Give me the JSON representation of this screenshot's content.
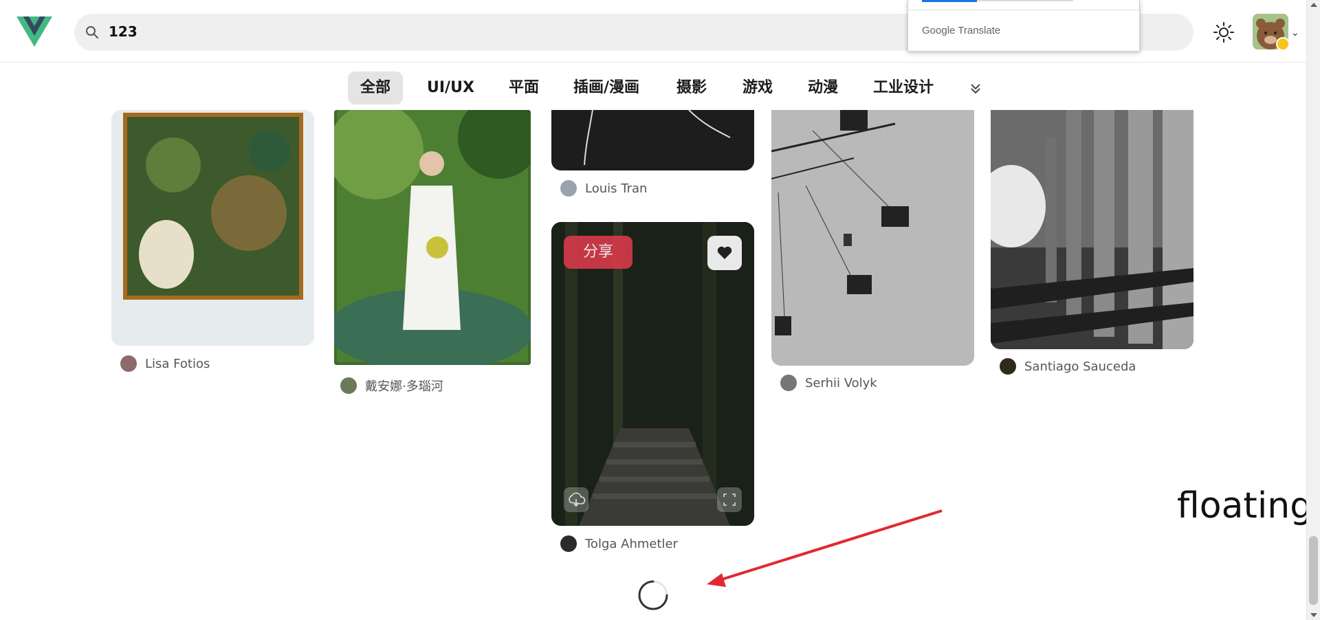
{
  "header": {
    "search": {
      "value": "123",
      "icon": "search-icon"
    },
    "theme_icon": "sun-icon",
    "avatar_icon": "bear-avatar"
  },
  "translate_popup": {
    "brand": "Google Translate"
  },
  "categories": {
    "items": [
      "全部",
      "UI/UX",
      "平面",
      "插画/漫画",
      "摄影",
      "游戏",
      "动漫",
      "工业设计"
    ],
    "active_index": 0,
    "more_icon": "double-chevron-down-icon"
  },
  "cards": [
    {
      "author": "Lisa Fotios"
    },
    {
      "author": "戴安娜·多瑙河"
    },
    {
      "author": "Louis Tran"
    },
    {
      "author": "Tolga Ahmetler",
      "share_label": "分享"
    },
    {
      "author": "Serhii Volyk"
    },
    {
      "author": "Santiago Sauceda"
    }
  ],
  "annotation": {
    "label": "floating"
  },
  "colors": {
    "accent_red": "#d93a4a",
    "active_tab_bg": "#e4e4e4",
    "search_bg": "#efefef",
    "logo_green": "#42b883",
    "logo_dark": "#35495e"
  }
}
